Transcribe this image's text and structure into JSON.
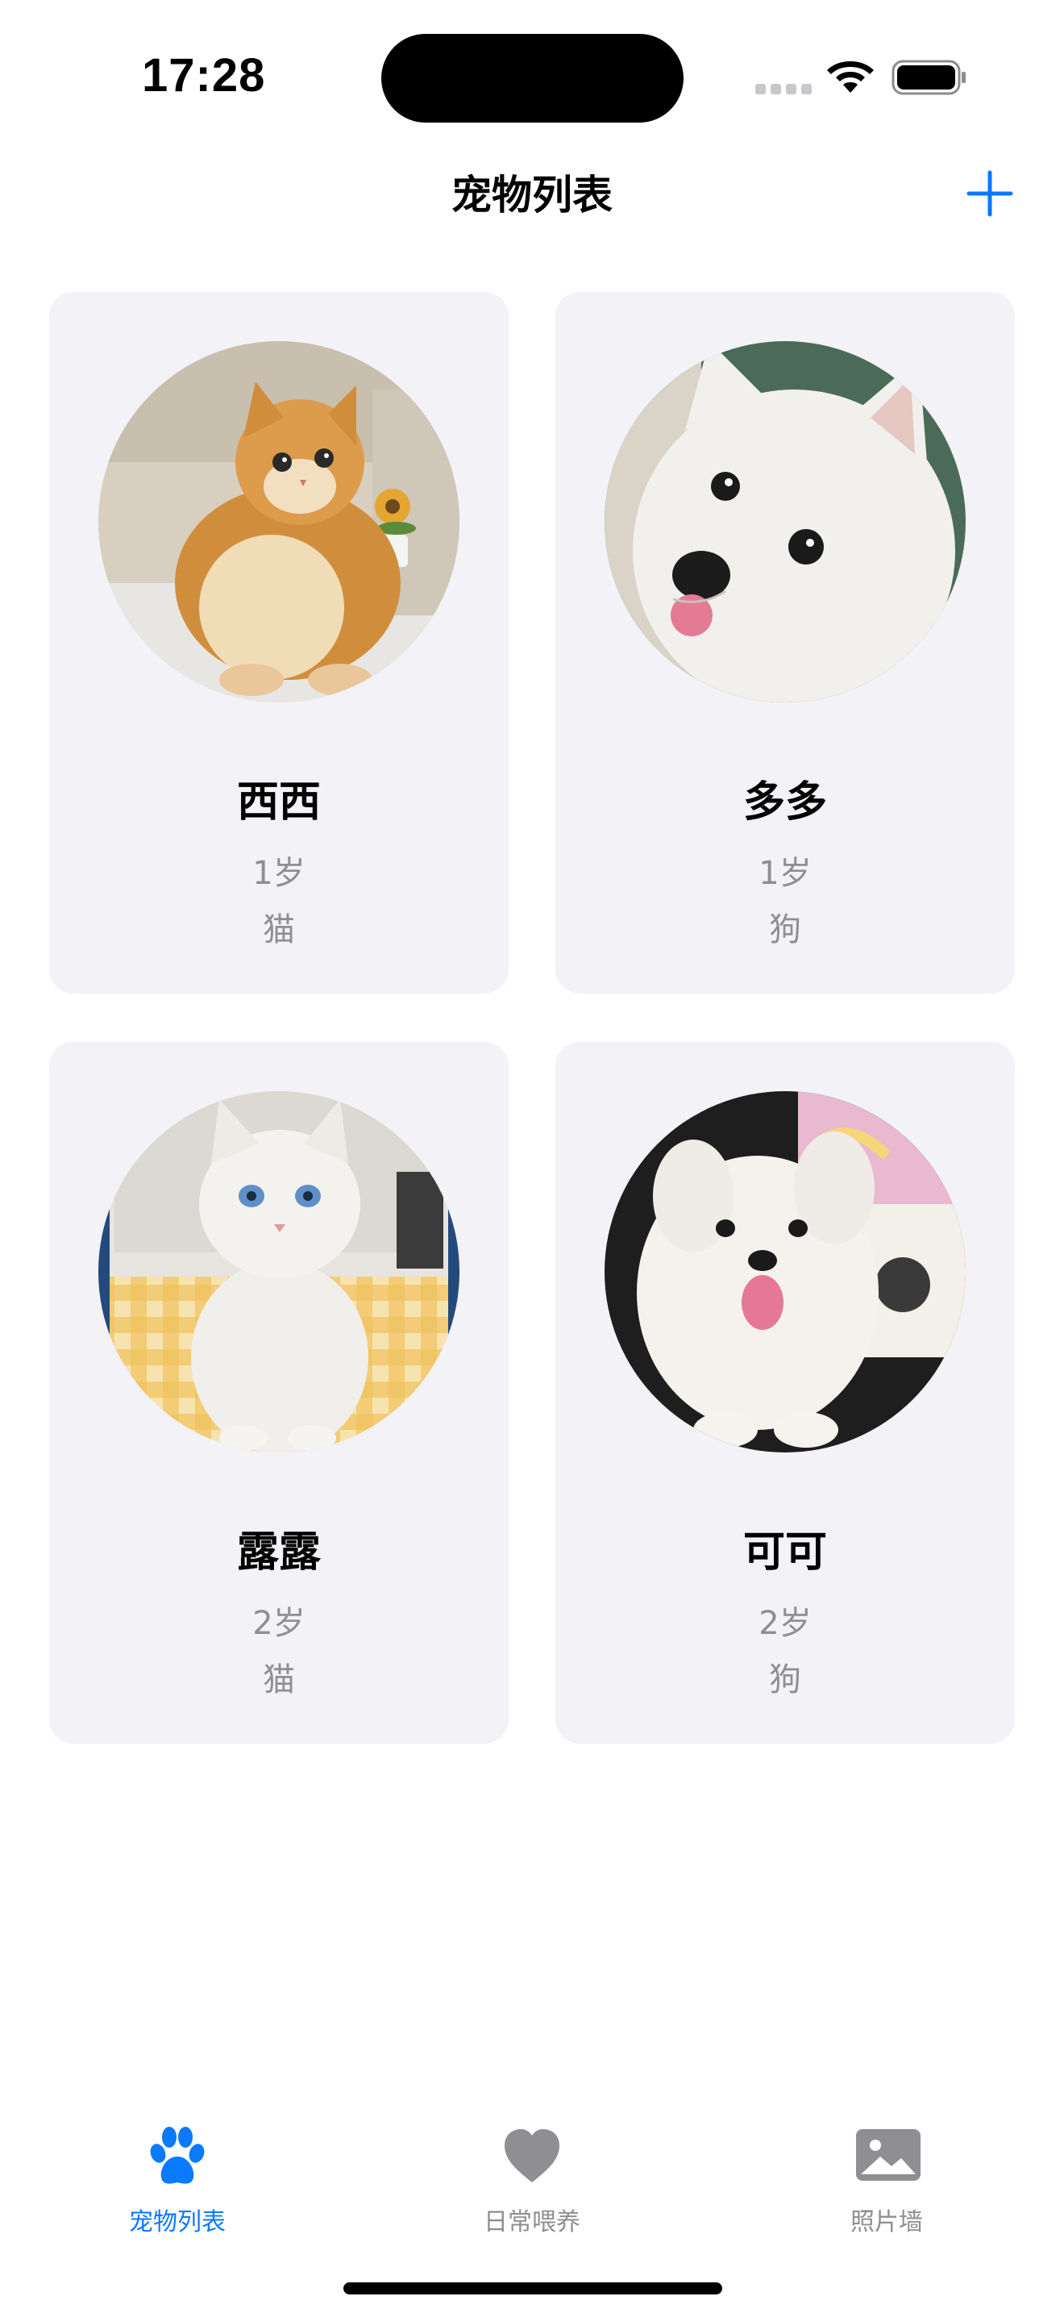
{
  "status_bar": {
    "time": "17:28"
  },
  "nav": {
    "title": "宠物列表",
    "add_icon": "plus-icon"
  },
  "pets": [
    {
      "name": "西西",
      "age": "1岁",
      "type": "猫",
      "photo_icon": "orange-kitten-photo"
    },
    {
      "name": "多多",
      "age": "1岁",
      "type": "狗",
      "photo_icon": "white-dog-photo"
    },
    {
      "name": "露露",
      "age": "2岁",
      "type": "猫",
      "photo_icon": "white-cat-photo"
    },
    {
      "name": "可可",
      "age": "2岁",
      "type": "狗",
      "photo_icon": "fluffy-puppy-photo"
    }
  ],
  "tabs": [
    {
      "label": "宠物列表",
      "icon": "paw-icon",
      "active": true
    },
    {
      "label": "日常喂养",
      "icon": "heart-icon",
      "active": false
    },
    {
      "label": "照片墙",
      "icon": "photo-icon",
      "active": false
    }
  ],
  "colors": {
    "accent": "#0a7aff",
    "inactive": "#8e8e93",
    "card_background": "#f2f2f7",
    "secondary_text": "#8e8e93"
  }
}
